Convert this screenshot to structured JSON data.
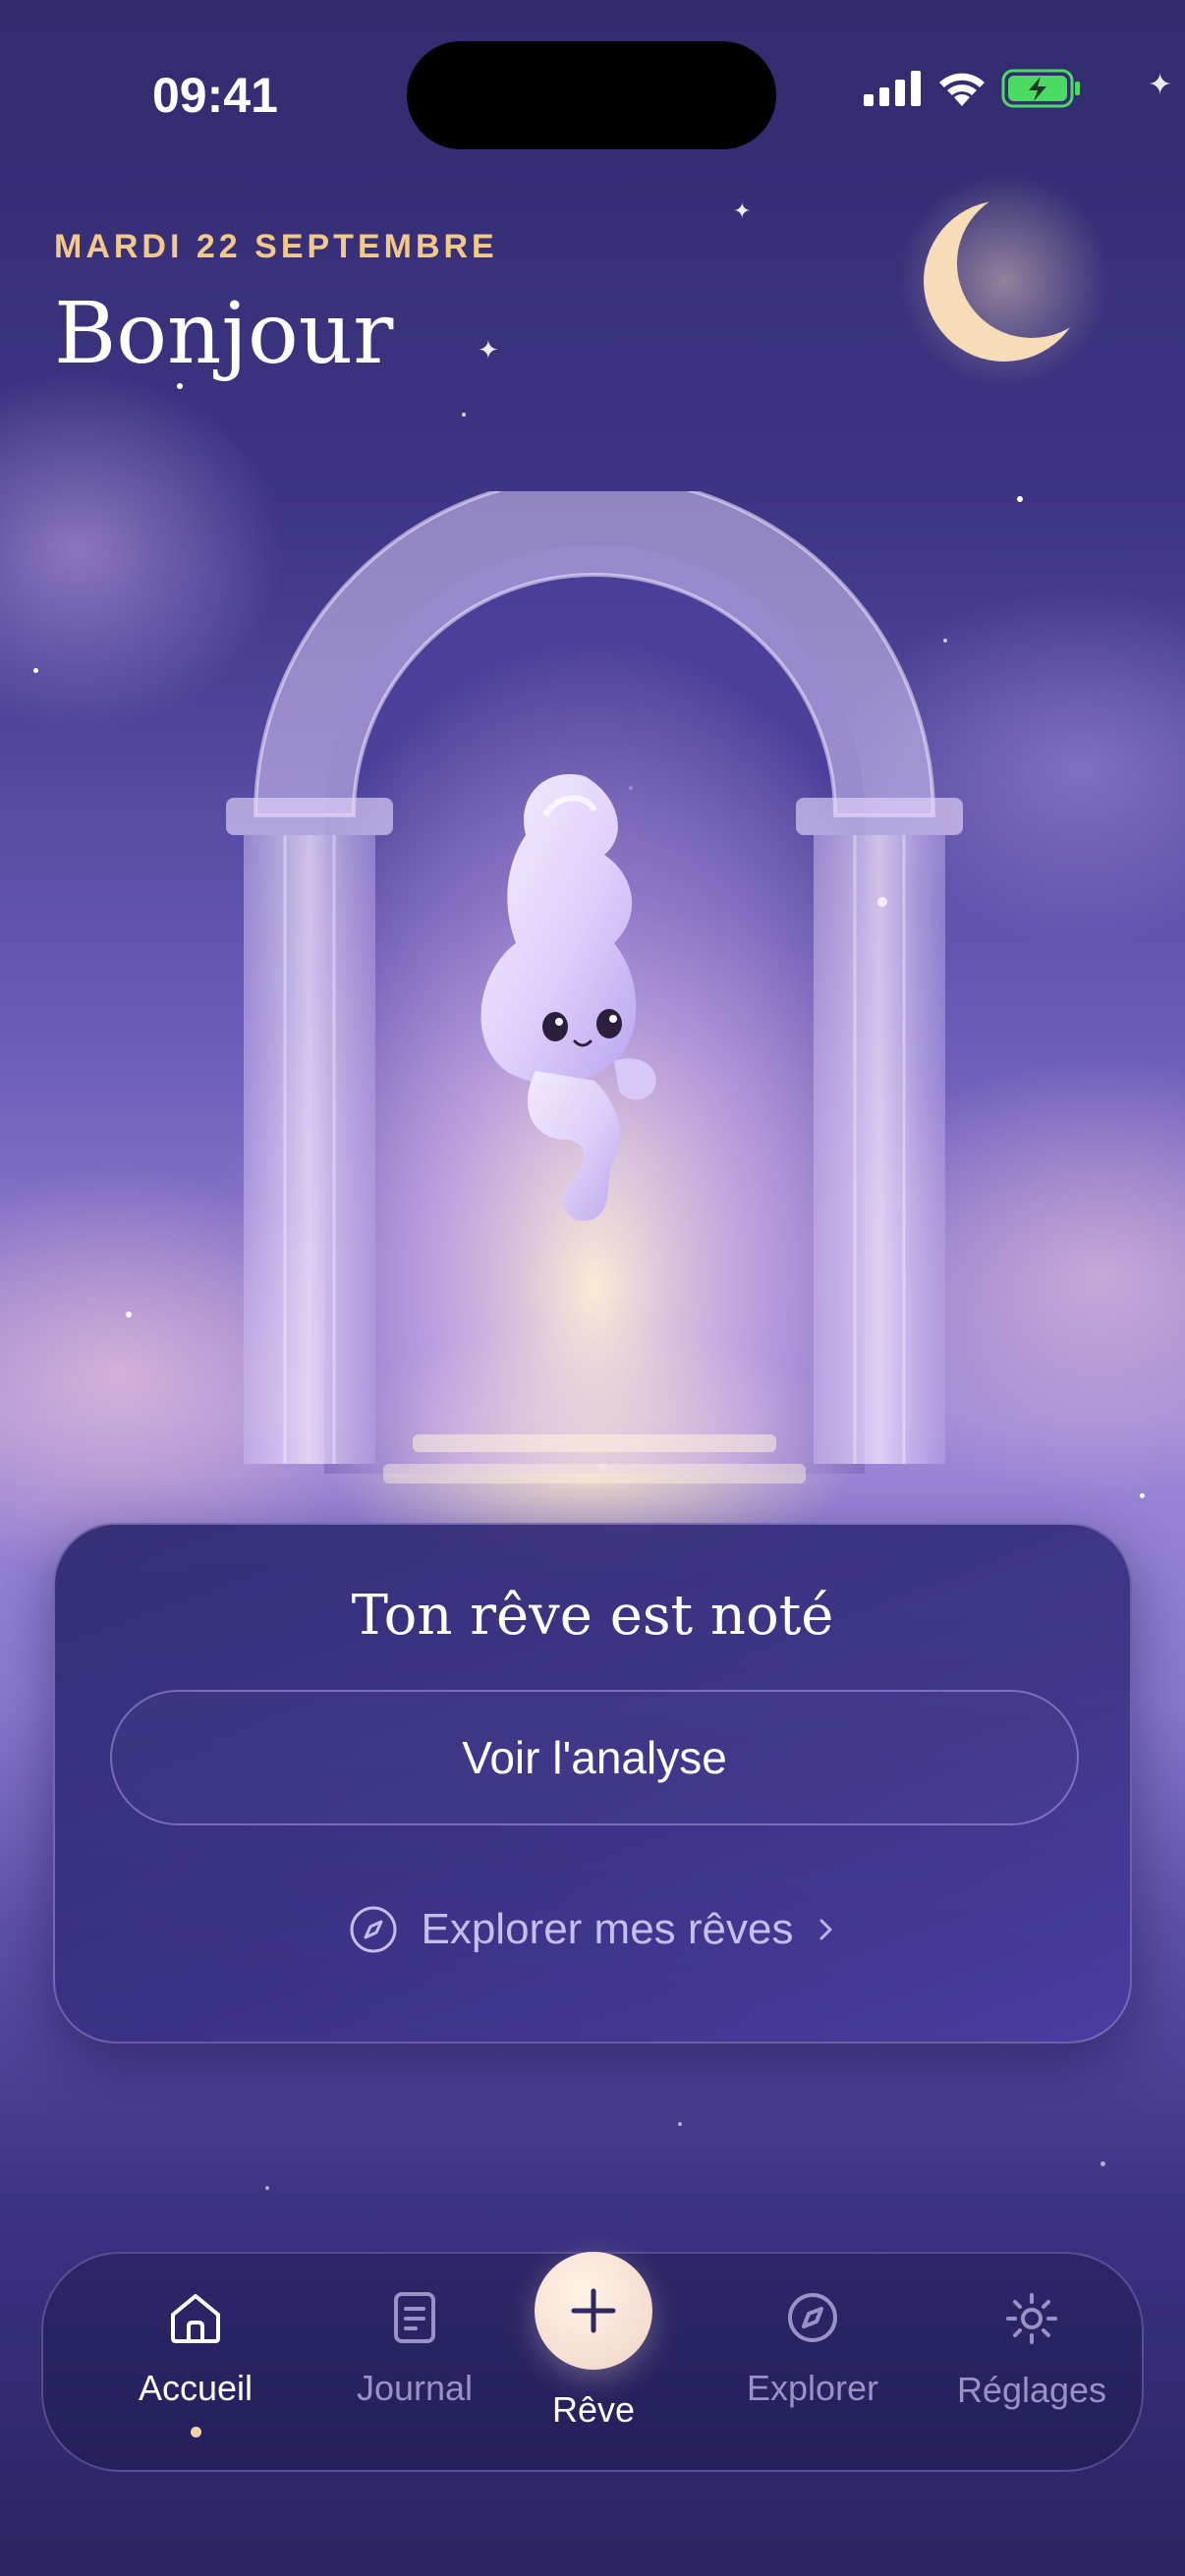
{
  "status_bar": {
    "time": "09:41"
  },
  "header": {
    "date": "MARDI 22 SEPTEMBRE",
    "greeting": "Bonjour"
  },
  "card": {
    "title": "Ton rêve est noté",
    "primary_button": "Voir l'analyse",
    "explore_link": "Explorer mes rêves",
    "explore_icon": "compass-icon",
    "chevron_icon": "chevron-right-icon"
  },
  "tab_bar": {
    "tabs": [
      {
        "label": "Accueil",
        "icon": "home-icon",
        "active": true
      },
      {
        "label": "Journal",
        "icon": "journal-icon",
        "active": false
      },
      {
        "label": "Rêve",
        "icon": "plus-icon",
        "active": false
      },
      {
        "label": "Explorer",
        "icon": "compass-icon",
        "active": false
      },
      {
        "label": "Réglages",
        "icon": "sun-icon",
        "active": false
      }
    ]
  },
  "colors": {
    "accent": "#f2c98b",
    "background": "#2a2560",
    "card": "#342e80",
    "battery": "#4cd964"
  }
}
